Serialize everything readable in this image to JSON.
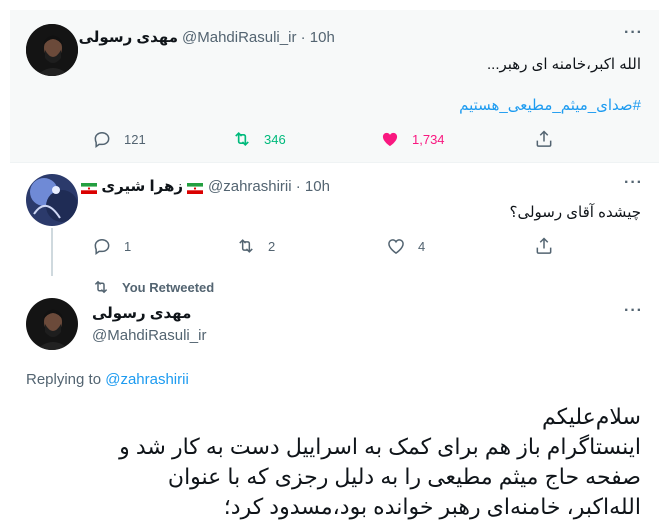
{
  "tweet1": {
    "name": "مهدی رسولی",
    "handle": "@MahdiRasuli_ir · 10h",
    "text": "الله اکبر،خامنه ای رهبر...",
    "hashtag": "#صدای_میثم_مطیعی_هستیم",
    "replies": "121",
    "retweets": "346",
    "likes": "1,734"
  },
  "tweet2": {
    "name": "زهرا شیری",
    "handle": "@zahrashirii · 10h",
    "text": "چیشده آقای رسولی؟",
    "replies": "1",
    "retweets": "2",
    "likes": "4"
  },
  "retweet_notice": "You Retweeted",
  "tweet3": {
    "name": "مهدی رسولی",
    "handle": "@MahdiRasuli_ir",
    "replying_prefix": "Replying to",
    "replying_handle": "@zahrashirii",
    "lines": [
      "سلام‌علیکم",
      "اینستاگرام باز هم برای کمک به اسراییل دست به کار شد و",
      "صفحه حاج میثم مطیعی را به دلیل رجزی که با عنوان",
      "الله‌اکبر، خامنه‌ای رهبر خوانده بود،مسدود کرد؛"
    ]
  },
  "colors": {
    "retweet_green": "#00ba7c",
    "like_pink": "#f91880",
    "link_blue": "#1d9bf0",
    "muted": "#536471"
  }
}
